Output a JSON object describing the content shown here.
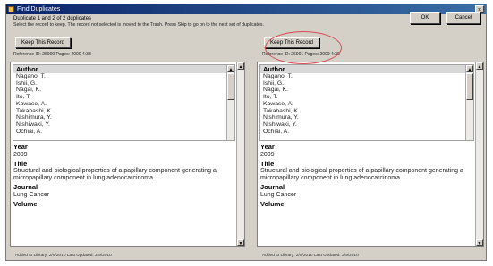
{
  "window": {
    "title": "Find Duplicates",
    "close_glyph": "×"
  },
  "header": {
    "subtitle": "Duplicate 1 and 2 of 2 duplicates",
    "instruction": "Select the record to keep. The record not selected is moved to the Trash. Press Skip to go on to the next set of duplicates."
  },
  "buttons": {
    "ok": "OK",
    "cancel": "Cancel"
  },
  "left": {
    "keep_label": "Keep This Record",
    "meta": "Reference ID: 26000   Pages: 2009 4:38",
    "authors_header": "Author",
    "authors": [
      "Nagano, T.",
      "Ishii, G.",
      "Nagai, K.",
      "Ito, T.",
      "Kawase, A.",
      "Takahashi, K.",
      "Nishimura, Y.",
      "Nishiwaki, Y.",
      "Ochiai, A."
    ],
    "year_label": "Year",
    "year": "2009",
    "title_label": "Title",
    "title": "Structural and biological properties of a papillary component generating a micropapillary component in lung adenocarcinoma",
    "journal_label": "Journal",
    "journal": "Lung Cancer",
    "volume_label": "Volume",
    "status": "Added to Library: 2/9/2010   Last Updated: 2/9/2010"
  },
  "right": {
    "keep_label": "Keep This Record",
    "meta": "Reference ID: 26001   Pages: 2009 4:38",
    "authors_header": "Author",
    "authors": [
      "Nagano, T.",
      "Ishii, G.",
      "Nagai, K.",
      "Ito, T.",
      "Kawase, A.",
      "Takahashi, K.",
      "Nishimura, Y.",
      "Nishiwaki, Y.",
      "Ochiai, A."
    ],
    "year_label": "Year",
    "year": "2009",
    "title_label": "Title",
    "title": "Structural and biological properties of a papillary component generating a micropapillary component in lung adenocarcinoma",
    "journal_label": "Journal",
    "journal": "Lung Cancer",
    "volume_label": "Volume",
    "status": "Added to Library: 2/9/2010   Last Updated: 2/9/2010"
  },
  "colors": {
    "highlight_ring": "#d64c55",
    "title_bar": "#0a246a"
  }
}
